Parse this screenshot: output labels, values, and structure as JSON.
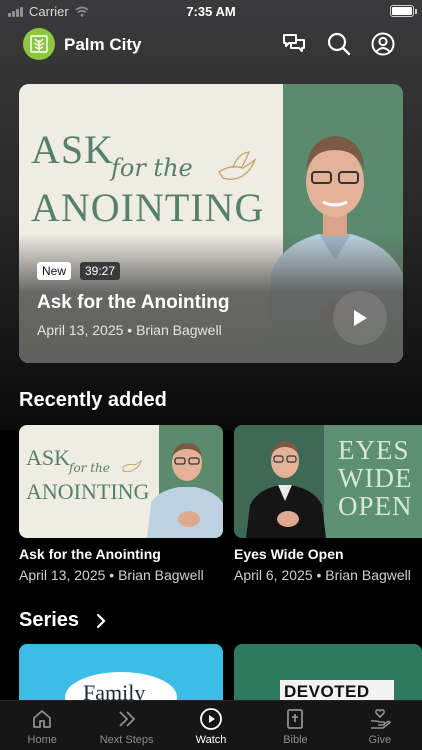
{
  "status_bar": {
    "carrier": "Carrier",
    "time": "7:35 AM"
  },
  "header": {
    "app_name": "Palm City",
    "icons": [
      "logo-icon",
      "chat-icon",
      "search-icon",
      "profile-icon"
    ]
  },
  "hero": {
    "art_title_top": "ASK",
    "art_title_script": "for the",
    "art_title_bottom": "ANOINTING",
    "badge_new": "New",
    "duration": "39:27",
    "title": "Ask for the Anointing",
    "meta": "April 13, 2025 • Brian Bagwell"
  },
  "recently_added": {
    "title": "Recently added",
    "items": [
      {
        "art_top": "ASK",
        "art_script": "for the",
        "art_bottom": "ANOINTING",
        "title": "Ask for the Anointing",
        "meta": "April 13, 2025 • Brian Bagwell"
      },
      {
        "art_line1": "EYES",
        "art_line2": "WIDE",
        "art_line3": "OPEN",
        "title": "Eyes Wide Open",
        "meta": "April 6, 2025 • Brian Bagwell"
      }
    ]
  },
  "series": {
    "title": "Series",
    "items": [
      {
        "label": "Family",
        "color": "#3bbde5"
      },
      {
        "label": "DEVOTED",
        "color": "#2f7a5e"
      }
    ]
  },
  "tab_bar": {
    "tabs": [
      {
        "label": "Home",
        "icon": "home-icon",
        "active": false
      },
      {
        "label": "Next Steps",
        "icon": "chevrons-icon",
        "active": false
      },
      {
        "label": "Watch",
        "icon": "play-circle-icon",
        "active": true
      },
      {
        "label": "Bible",
        "icon": "bible-icon",
        "active": false
      },
      {
        "label": "Give",
        "icon": "give-icon",
        "active": false
      }
    ]
  },
  "colors": {
    "accent_logo": "#8dc63f",
    "art_green": "#5b8a6c",
    "art_cream": "#efece4"
  }
}
